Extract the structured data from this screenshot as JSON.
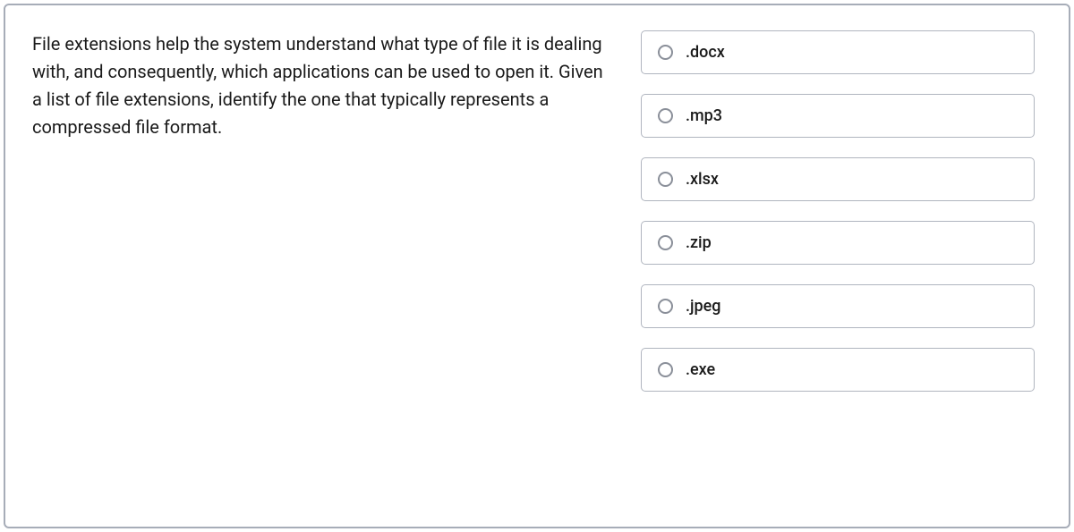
{
  "question": {
    "text": "File extensions help the system understand what type of file it is dealing with, and consequently, which applications can be used to open it. Given a list of file extensions, identify the one that typically represents a compressed file format."
  },
  "options": [
    {
      "label": ".docx"
    },
    {
      "label": ".mp3"
    },
    {
      "label": ".xlsx"
    },
    {
      "label": ".zip"
    },
    {
      "label": ".jpeg"
    },
    {
      "label": ".exe"
    }
  ]
}
